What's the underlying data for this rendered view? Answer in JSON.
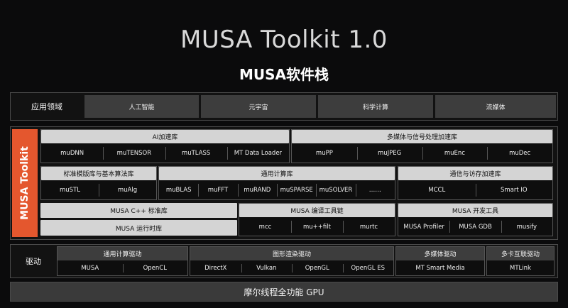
{
  "title": "MUSA Toolkit 1.0",
  "subtitle": "MUSA软件栈",
  "app_domain": {
    "label": "应用领域",
    "items": [
      "人工智能",
      "元宇宙",
      "科学计算",
      "流媒体"
    ]
  },
  "toolkit": {
    "label": "MUSA Toolkit",
    "ai": {
      "header": "AI加速库",
      "items": [
        "muDNN",
        "muTENSOR",
        "muTLASS",
        "MT Data Loader"
      ]
    },
    "media": {
      "header": "多媒体与信号处理加速库",
      "items": [
        "muPP",
        "muJPEG",
        "muEnc",
        "muDec"
      ]
    },
    "stl": {
      "header": "标准模版库与基本算法库",
      "items": [
        "muSTL",
        "muAlg"
      ]
    },
    "general": {
      "header": "通用计算库",
      "items": [
        "muBLAS",
        "muFFT",
        "muRAND",
        "muSPARSE",
        "muSOLVER",
        "……"
      ]
    },
    "comm": {
      "header": "通信与访存加速库",
      "items": [
        "MCCL",
        "Smart IO"
      ]
    },
    "cpp": {
      "header": "MUSA C++ 标准库"
    },
    "runtime": {
      "header": "MUSA 运行时库"
    },
    "compiler": {
      "header": "MUSA 编译工具链",
      "items": [
        "mcc",
        "mu++filt",
        "murtc"
      ]
    },
    "devtools": {
      "header": "MUSA 开发工具",
      "items": [
        "MUSA Profiler",
        "MUSA GDB",
        "musify"
      ]
    }
  },
  "driver": {
    "label": "驱动",
    "compute": {
      "header": "通用计算驱动",
      "items": [
        "MUSA",
        "OpenCL"
      ]
    },
    "graphics": {
      "header": "图形渲染驱动",
      "items": [
        "DirectX",
        "Vulkan",
        "OpenGL",
        "OpenGL ES"
      ]
    },
    "multimedia": {
      "header": "多媒体驱动",
      "items": [
        "MT Smart Media"
      ]
    },
    "link": {
      "header": "多卡互联驱动",
      "items": [
        "MTLink"
      ]
    }
  },
  "gpu": {
    "label": "摩尔线程全功能 GPU"
  },
  "colors": {
    "accent": "#e4572e",
    "header_gray": "#d4d4d4",
    "cell_gray": "#3d3d3d"
  }
}
